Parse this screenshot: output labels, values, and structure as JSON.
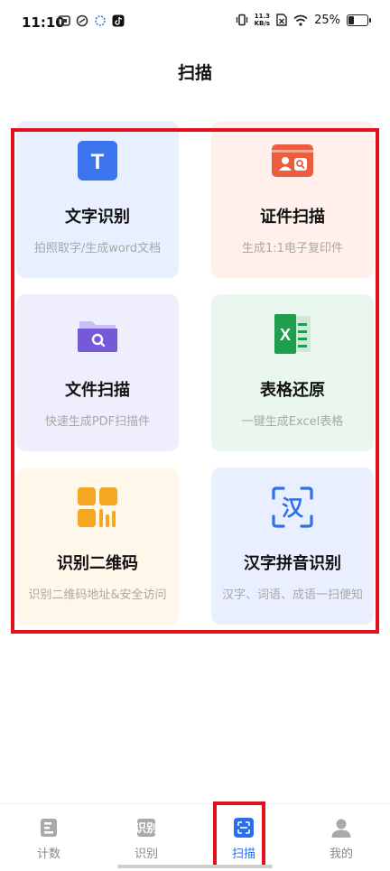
{
  "status_bar": {
    "time": "11:10",
    "speed_value": "11.3",
    "speed_unit": "KB/s",
    "battery": "25%"
  },
  "header": {
    "title": "扫描"
  },
  "features": [
    {
      "title": "文字识别",
      "subtitle": "拍照取字/生成word文档",
      "icon": "text-recognition-icon",
      "color": "#3c74ee"
    },
    {
      "title": "证件扫描",
      "subtitle": "生成1:1电子复印件",
      "icon": "id-card-icon",
      "color": "#ec5d3d"
    },
    {
      "title": "文件扫描",
      "subtitle": "快速生成PDF扫描件",
      "icon": "folder-search-icon",
      "color": "#7559db"
    },
    {
      "title": "表格还原",
      "subtitle": "一键生成Excel表格",
      "icon": "excel-icon",
      "color": "#1f9e4d"
    },
    {
      "title": "识别二维码",
      "subtitle": "识别二维码地址&安全访问",
      "icon": "qr-code-icon",
      "color": "#f5a623"
    },
    {
      "title": "汉字拼音识别",
      "subtitle": "汉字、词语、成语一扫便知",
      "icon": "pinyin-scan-icon",
      "color": "#2f6fe8"
    }
  ],
  "icon_glyphs": {
    "text": "T",
    "excel": "X",
    "pinyin": "汉"
  },
  "tabs": [
    {
      "label": "计数",
      "icon": "count-icon",
      "active": false
    },
    {
      "label": "识别",
      "icon": "recognize-icon",
      "active": false
    },
    {
      "label": "扫描",
      "icon": "scan-icon",
      "active": true
    },
    {
      "label": "我的",
      "icon": "profile-icon",
      "active": false
    }
  ]
}
